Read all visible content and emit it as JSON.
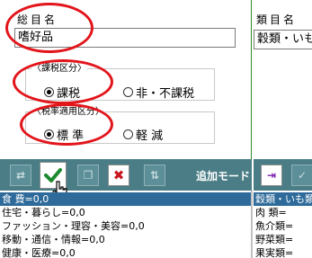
{
  "form": {
    "total_name_label": "総目名",
    "total_name_value": "嗜好品",
    "category_label": "類目名",
    "category_value": "穀類・いも"
  },
  "tax_group": {
    "legend": "〈課税区分〉",
    "options": [
      "課税",
      "非・不課税"
    ],
    "selected": "課税"
  },
  "rate_group": {
    "legend": "〈税率適用区分〉",
    "options": [
      "標 準",
      "軽 減"
    ],
    "selected": "標 準"
  },
  "toolbar": {
    "mode_label": "追加モード"
  },
  "left_list": {
    "rows": [
      "食 費=0,0",
      "住宅・暮らし=0,0",
      "ファッション・理容・美容=0,0",
      "移動・通信・情報=0,0",
      "健康・医療=0,0"
    ]
  },
  "right_list": {
    "rows": [
      "穀類・いも類=",
      "肉 類=",
      "魚介類=",
      "野菜類=",
      "果実類="
    ]
  },
  "colors": {
    "toolbar": "#4a7d86",
    "highlight": "#e2151b",
    "selection": "#2f6b9a",
    "confirm_check": "#1b8a2e"
  }
}
